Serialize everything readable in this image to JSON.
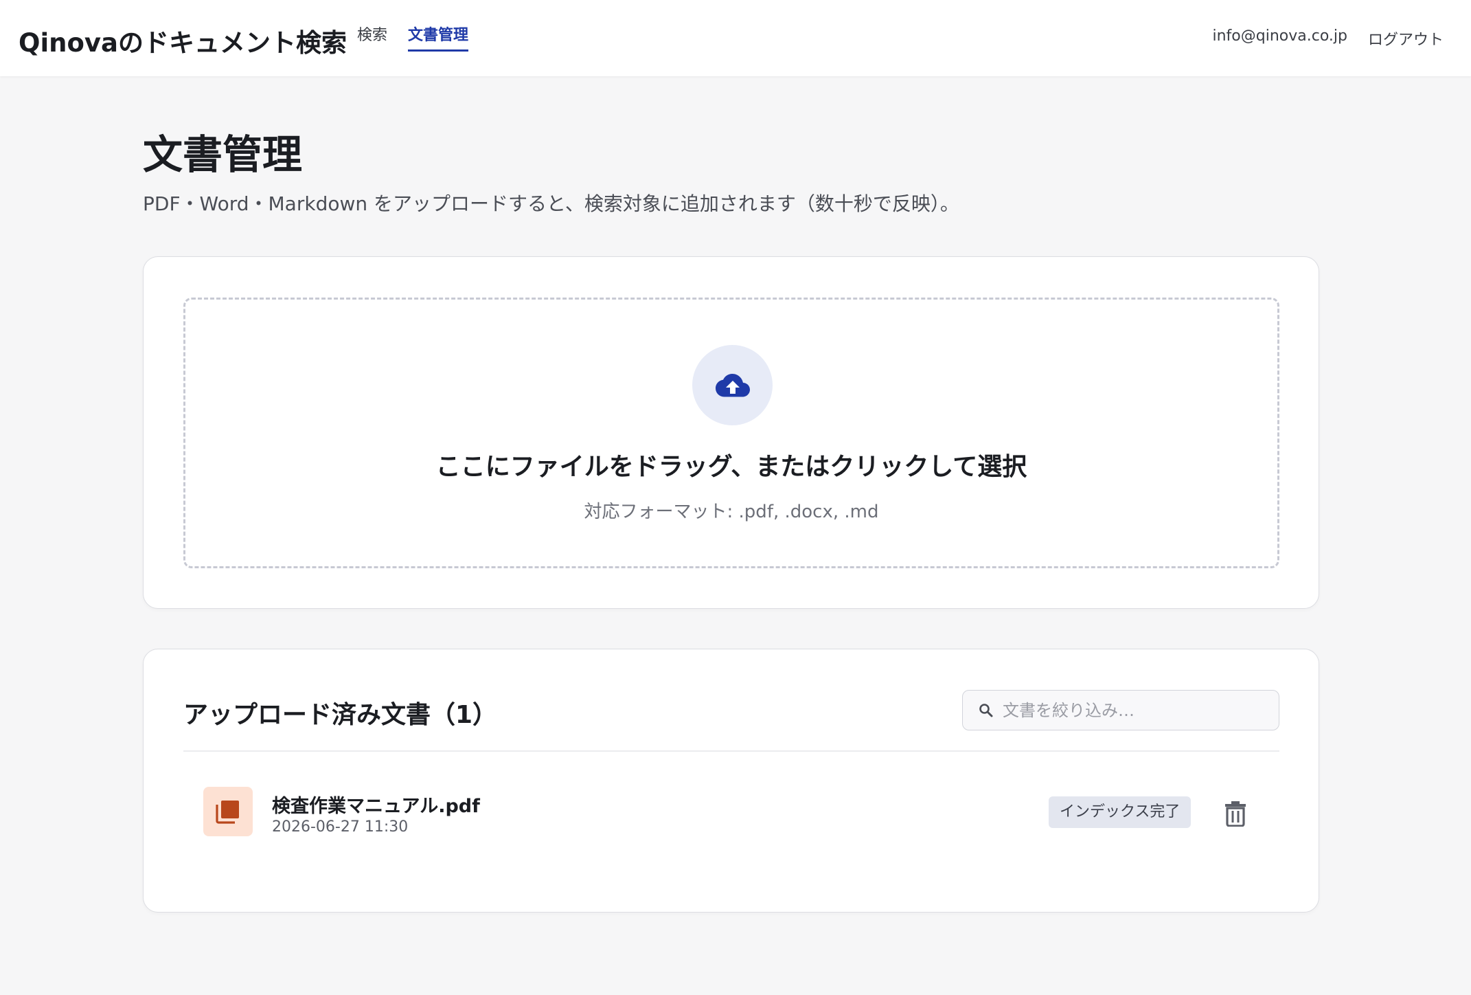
{
  "header": {
    "brand": "Qinovaのドキュメント検索",
    "nav": [
      {
        "label": "検索",
        "active": false
      },
      {
        "label": "文書管理",
        "active": true
      }
    ],
    "user_email": "info@qinova.co.jp",
    "logout_label": "ログアウト"
  },
  "page": {
    "title": "文書管理",
    "description": "PDF・Word・Markdown をアップロードすると、検索対象に追加されます（数十秒で反映）。"
  },
  "upload": {
    "icon": "cloud-upload-icon",
    "title": "ここにファイルをドラッグ、またはクリックして選択",
    "formats": "対応フォーマット: .pdf, .docx, .md"
  },
  "documents": {
    "title": "アップロード済み文書（1）",
    "search_placeholder": "文書を絞り込み…",
    "items": [
      {
        "name": "検査作業マニュアル.pdf",
        "date": "2026-06-27 11:30",
        "file_type": "PDF",
        "status": "インデックス完了"
      }
    ]
  },
  "colors": {
    "accent": "#1f3aa8",
    "pdf_thumb_bg": "#fde1d3",
    "pdf_icon": "#b8471c",
    "badge_bg": "#e3e6ef"
  }
}
